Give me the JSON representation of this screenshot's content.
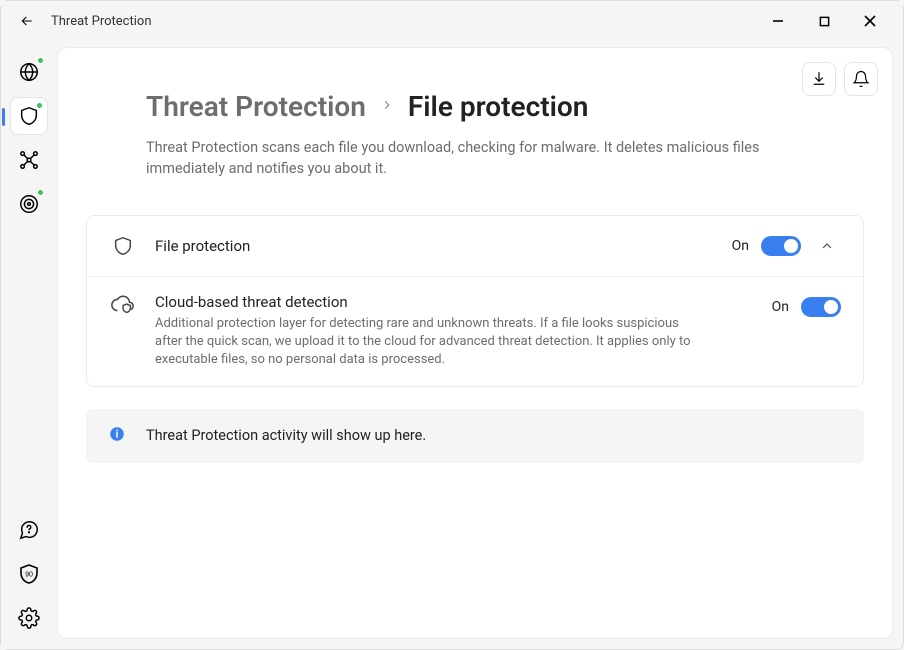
{
  "titlebar": {
    "title": "Threat Protection"
  },
  "breadcrumb": {
    "root": "Threat Protection",
    "current": "File protection"
  },
  "description": "Threat Protection scans each file you download, checking for malware. It deletes malicious files immediately and notifies you about it.",
  "settings": {
    "file_protection": {
      "title": "File protection",
      "status": "On"
    },
    "cloud_detection": {
      "title": "Cloud-based threat detection",
      "sub": "Additional protection layer for detecting rare and unknown threats. If a file looks suspicious after the quick scan, we upload it to the cloud for advanced threat detection. It applies only to executable files, so no personal data is processed.",
      "status": "On"
    }
  },
  "info_banner": "Threat Protection activity will show up here.",
  "sidebar": {
    "items": [
      {
        "id": "globe",
        "has_dot": true
      },
      {
        "id": "shield",
        "has_dot": true,
        "active": true
      },
      {
        "id": "mesh",
        "has_dot": false
      },
      {
        "id": "target",
        "has_dot": true
      }
    ],
    "bottom": [
      {
        "id": "help"
      },
      {
        "id": "shield-days",
        "badge": "90"
      },
      {
        "id": "settings"
      }
    ]
  }
}
